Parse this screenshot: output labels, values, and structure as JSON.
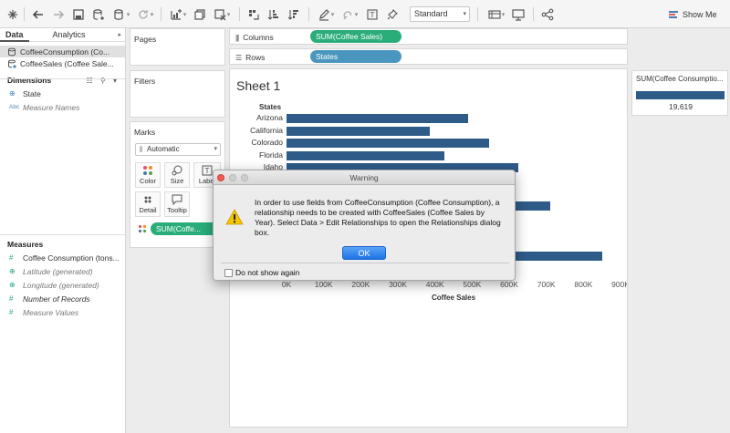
{
  "toolbar": {
    "view_mode": "Standard",
    "show_me_label": "Show Me"
  },
  "data_pane": {
    "tabs": [
      {
        "label": "Data"
      },
      {
        "label": "Analytics"
      }
    ],
    "data_sources": [
      {
        "label": "CoffeeConsumption (Co..."
      },
      {
        "label": "CoffeeSales (Coffee Sale..."
      }
    ],
    "dimensions_header": "Dimensions",
    "dimensions": [
      {
        "type": "⊕",
        "label": "State"
      },
      {
        "type": "Abc",
        "label": "Measure Names"
      }
    ],
    "measures_header": "Measures",
    "measures": [
      {
        "type": "#",
        "label": "Coffee Consumption (tons..."
      },
      {
        "type": "⊕",
        "label": "Latitude (generated)"
      },
      {
        "type": "⊕",
        "label": "Longitude (generated)"
      },
      {
        "type": "#",
        "label": "Number of Records"
      },
      {
        "type": "#",
        "label": "Measure Values"
      }
    ]
  },
  "shelves": {
    "pages_label": "Pages",
    "filters_label": "Filters",
    "columns_label": "Columns",
    "columns_pill": "SUM(Coffee Sales)",
    "rows_label": "Rows",
    "rows_pill": "States"
  },
  "marks": {
    "title": "Marks",
    "type": "Automatic",
    "buttons": [
      {
        "label": "Color"
      },
      {
        "label": "Size"
      },
      {
        "label": "Label"
      },
      {
        "label": "Detail"
      },
      {
        "label": "Tooltip"
      }
    ],
    "pill": "SUM(Coffe..."
  },
  "sheet": {
    "title": "Sheet 1"
  },
  "chart_data": {
    "type": "bar",
    "orientation": "horizontal",
    "row_header": "States",
    "categories": [
      "Arizona",
      "California",
      "Colorado",
      "Florida",
      "Idaho"
    ],
    "values": [
      490000,
      385000,
      545000,
      425000,
      625000
    ],
    "hidden_bar_values": [
      710000,
      850000
    ],
    "xlabel": "Coffee Sales",
    "ticks": [
      "0K",
      "100K",
      "200K",
      "300K",
      "400K",
      "500K",
      "600K",
      "700K",
      "800K",
      "900K"
    ],
    "xlim": [
      0,
      900000
    ],
    "color": "#2e5b88"
  },
  "legend": {
    "title": "SUM(Coffee Consumptio...",
    "value": "19,619"
  },
  "dialog": {
    "title": "Warning",
    "message": "In order to use fields from CoffeeConsumption (Coffee Consumption), a relationship needs to be created with CoffeeSales (Coffee Sales by Year). Select Data > Edit Relationships to open the Relationships dialog box.",
    "ok_label": "OK",
    "checkbox_label": "Do not show again"
  }
}
